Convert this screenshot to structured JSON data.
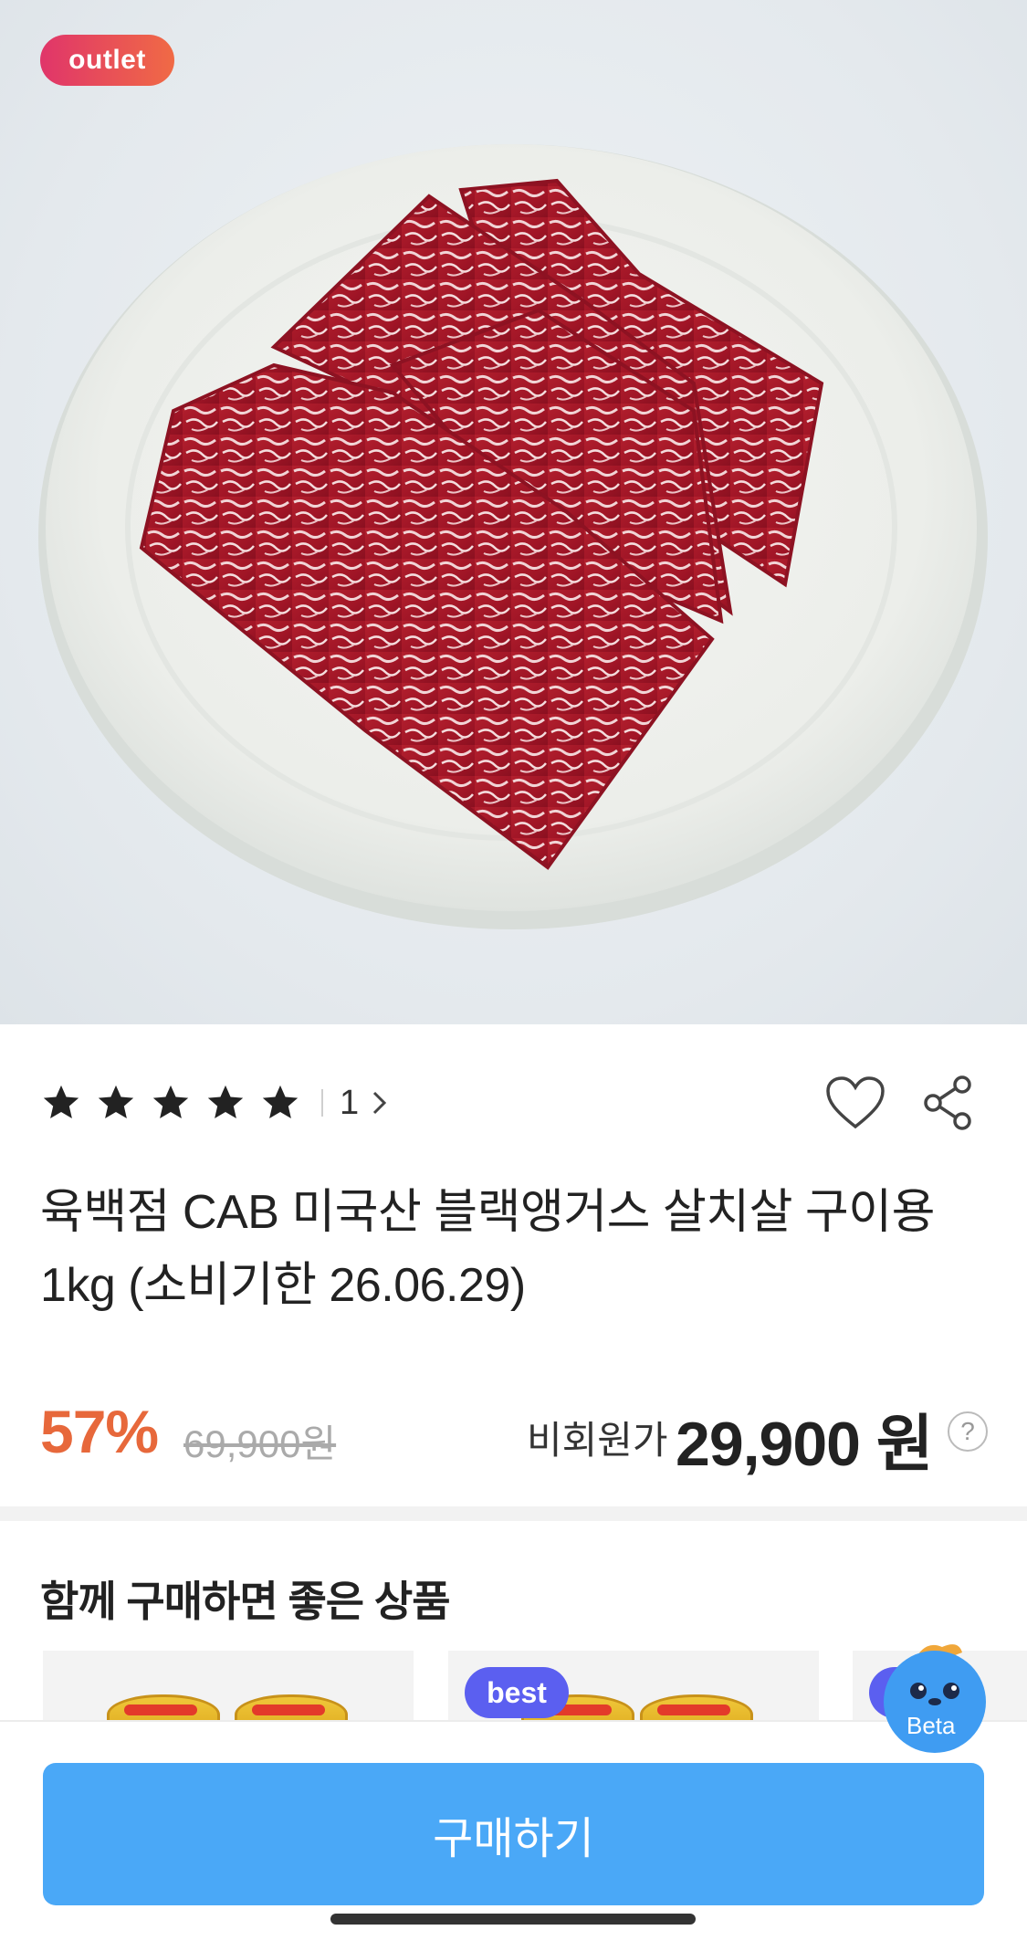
{
  "hero": {
    "badge_label": "outlet"
  },
  "rating": {
    "stars": 5,
    "count": "1"
  },
  "product": {
    "title_line1": "육백점 CAB 미국산 블랙앵거스 살치살 구이용",
    "title_line2": "1kg (소비기한 26.06.29)"
  },
  "price": {
    "discount": "57%",
    "original": "69,900원",
    "member_label": "비회원가",
    "sale": "29,900 원",
    "help": "?"
  },
  "recommend": {
    "title": "함께 구매하면 좋은 상품",
    "badge": "best"
  },
  "assistant": {
    "label": "Beta"
  },
  "cta": {
    "buy_label": "구매하기"
  },
  "colors": {
    "discount": "#e7683b",
    "buy_button": "#4aa8f7",
    "best_badge": "#5b5ff0"
  }
}
